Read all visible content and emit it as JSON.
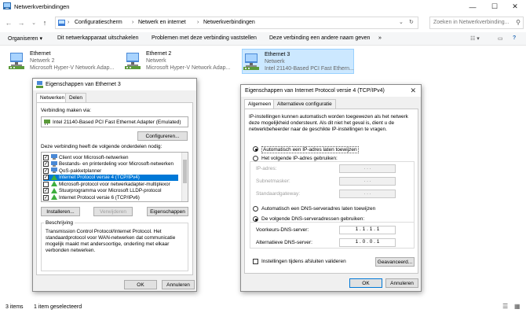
{
  "window": {
    "title": "Netwerkverbindingen",
    "controls": {
      "minimize": "—",
      "maximize": "☐",
      "close": "✕"
    }
  },
  "nav": {
    "breadcrumbs": [
      "Configuratiescherm",
      "Netwerk en internet",
      "Netwerkverbindingen"
    ],
    "search_placeholder": "Zoeken in Netwerkverbinding..."
  },
  "commands": [
    "Organiseren ▾",
    "Dit netwerkapparaat uitschakelen",
    "Problemen met deze verbinding vaststellen",
    "Deze verbinding een andere naam geven",
    "»"
  ],
  "connections": [
    {
      "name": "Ethernet",
      "status": "Netwerk 2",
      "adapter": "Microsoft Hyper-V Network Adap..."
    },
    {
      "name": "Ethernet 2",
      "status": "Netwerk",
      "adapter": "Microsoft Hyper-V Network Adap..."
    },
    {
      "name": "Ethernet 3",
      "status": "Netwerk",
      "adapter": "Intel 21140-Based PCI Fast Ethern..."
    }
  ],
  "status": {
    "items": "3 items",
    "selected": "1 item geselecteerd"
  },
  "props": {
    "title": "Eigenschappen van Ethernet 3",
    "tabs": [
      "Netwerken",
      "Delen"
    ],
    "connect_using_label": "Verbinding maken via:",
    "adapter": "Intel 21140-Based PCI Fast Ethernet Adapter (Emulated)",
    "configure": "Configureren...",
    "components_label": "Deze verbinding heeft de volgende onderdelen nodig:",
    "components": [
      {
        "label": "Client voor Microsoft-netwerken",
        "checked": true
      },
      {
        "label": "Bestands- en printerdeling voor Microsoft-netwerken",
        "checked": true
      },
      {
        "label": "QoS-pakketplanner",
        "checked": true
      },
      {
        "label": "Internet Protocol versie 4 (TCP/IPv4)",
        "checked": true
      },
      {
        "label": "Microsoft-protocol voor netwerkadapter-multiplexor",
        "checked": false
      },
      {
        "label": "Stuurprogramma voor Microsoft LLDP-protocol",
        "checked": true
      },
      {
        "label": "Internet Protocol versie 6 (TCP/IPv6)",
        "checked": true
      }
    ],
    "install": "Installeren...",
    "uninstall": "Verwijderen",
    "properties": "Eigenschappen",
    "desc_label": "Beschrijving",
    "desc_text": "Transmission Control Protocol/Internet Protocol. Het standaardprotocol voor WAN-netwerken dat communicatie mogelijk maakt met andersoortige, onderling met elkaar verbonden netwerken.",
    "ok": "OK",
    "cancel": "Annuleren"
  },
  "ipv4": {
    "title": "Eigenschappen van Internet Protocol versie 4 (TCP/IPv4)",
    "tabs": [
      "Algemeen",
      "Alternatieve configuratie"
    ],
    "intro": "IP-instellingen kunnen automatisch worden toegewezen als het netwerk deze mogelijkheid ondersteunt. Als dit niet het geval is, dient u de netwerkbeheerder naar de geschikte IP-instellingen te vragen.",
    "auto_ip": "Automatisch een IP-adres laten toewijzen",
    "manual_ip": "Het volgende IP-adres gebruiken:",
    "ip_label": "IP-adres:",
    "mask_label": "Subnetmasker:",
    "gw_label": "Standaardgateway:",
    "empty_ip": ".        .        .",
    "auto_dns": "Automatisch een DNS-serveradres laten toewijzen",
    "manual_dns": "De volgende DNS-serveradressen gebruiken:",
    "pref_dns_label": "Voorkeurs-DNS-server:",
    "pref_dns": "1  .  1  .  1  .  1",
    "alt_dns_label": "Alternatieve DNS-server:",
    "alt_dns": "1  .  0  .  0  .  1",
    "validate": "Instellingen tijdens afsluiten valideren",
    "advanced": "Geavanceerd...",
    "ok": "OK",
    "cancel": "Annuleren"
  }
}
